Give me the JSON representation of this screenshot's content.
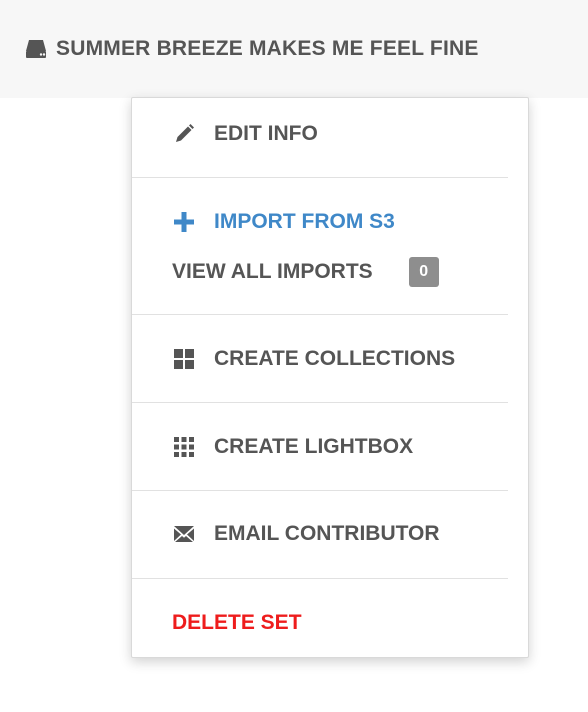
{
  "header": {
    "icon": "hard-drive-icon",
    "title": "SUMMER BREEZE MAKES ME FEEL FINE"
  },
  "menu": {
    "edit_info": {
      "label": "EDIT INFO",
      "icon": "pencil-icon"
    },
    "import_s3": {
      "label": "IMPORT FROM S3",
      "icon": "plus-icon",
      "color": "#3f88c8"
    },
    "view_imports": {
      "label": "VIEW ALL IMPORTS",
      "count": "0"
    },
    "create_collections": {
      "label": "CREATE COLLECTIONS",
      "icon": "grid-large-icon"
    },
    "create_lightbox": {
      "label": "CREATE LIGHTBOX",
      "icon": "grid-small-icon"
    },
    "email_contributor": {
      "label": "EMAIL CONTRIBUTOR",
      "icon": "envelope-icon"
    },
    "delete_set": {
      "label": "DELETE SET",
      "color": "#ee1c1c"
    }
  }
}
